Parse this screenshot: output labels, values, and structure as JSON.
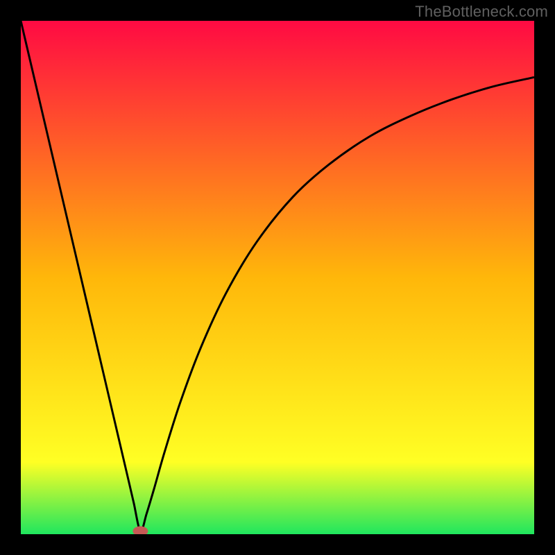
{
  "watermark": "TheBottleneck.com",
  "colors": {
    "top": "#ff0a43",
    "mid": "#ffb70a",
    "low": "#ffff24",
    "bottom": "#1fe65e",
    "marker": "#c55a55",
    "curve": "#000000",
    "frame": "#000000"
  },
  "chart_data": {
    "type": "line",
    "title": "",
    "xlabel": "",
    "ylabel": "",
    "xlim": [
      0,
      1
    ],
    "ylim": [
      0,
      1
    ],
    "minimum_x": 0.233,
    "series": [
      {
        "name": "curve",
        "x": [
          0.0,
          0.03,
          0.06,
          0.09,
          0.12,
          0.15,
          0.18,
          0.21,
          0.22,
          0.233,
          0.245,
          0.26,
          0.28,
          0.31,
          0.35,
          0.4,
          0.46,
          0.53,
          0.6,
          0.68,
          0.76,
          0.84,
          0.92,
          1.0
        ],
        "y": [
          1.0,
          0.872,
          0.744,
          0.616,
          0.488,
          0.36,
          0.232,
          0.104,
          0.061,
          0.006,
          0.04,
          0.09,
          0.16,
          0.255,
          0.362,
          0.47,
          0.57,
          0.657,
          0.72,
          0.775,
          0.815,
          0.847,
          0.872,
          0.89
        ]
      }
    ],
    "marker": {
      "name": "min-marker",
      "x": 0.233,
      "y": 0.006,
      "rx": 11,
      "ry": 7
    }
  }
}
